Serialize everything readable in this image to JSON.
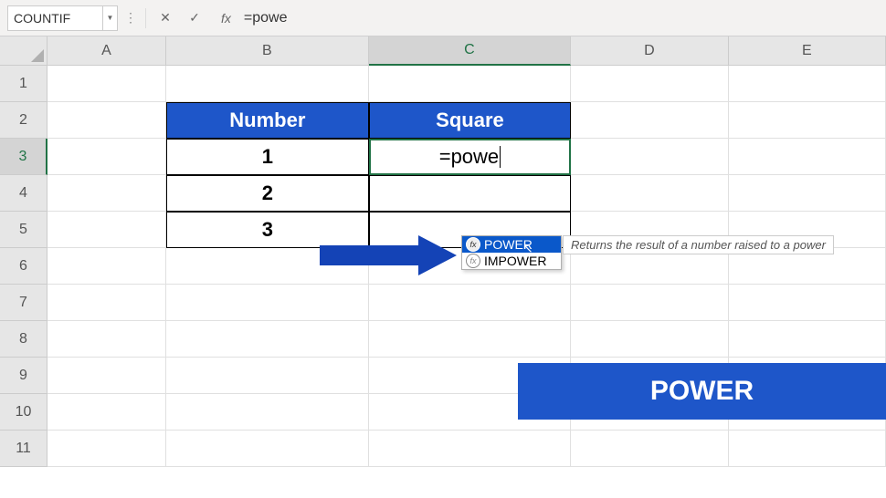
{
  "formula_bar": {
    "name_box": "COUNTIF",
    "fx_label": "fx",
    "formula_text": "=powe"
  },
  "columns": [
    "A",
    "B",
    "C",
    "D",
    "E"
  ],
  "rows": [
    "1",
    "2",
    "3",
    "4",
    "5",
    "6",
    "7",
    "8",
    "9",
    "10",
    "11"
  ],
  "active_col": "C",
  "active_row": "3",
  "table": {
    "header_number": "Number",
    "header_square": "Square",
    "b3": "1",
    "b4": "2",
    "b5": "3",
    "c3": "=powe"
  },
  "autocomplete": {
    "items": [
      {
        "label": "POWER",
        "selected": true
      },
      {
        "label": "IMPOWER",
        "selected": false
      }
    ],
    "tooltip": "Returns the result of a number raised to a power"
  },
  "banner": "POWER",
  "icons": {
    "cancel": "✕",
    "enter": "✓",
    "fx": "fx",
    "dropdown": "▼",
    "expand": "⋮"
  }
}
